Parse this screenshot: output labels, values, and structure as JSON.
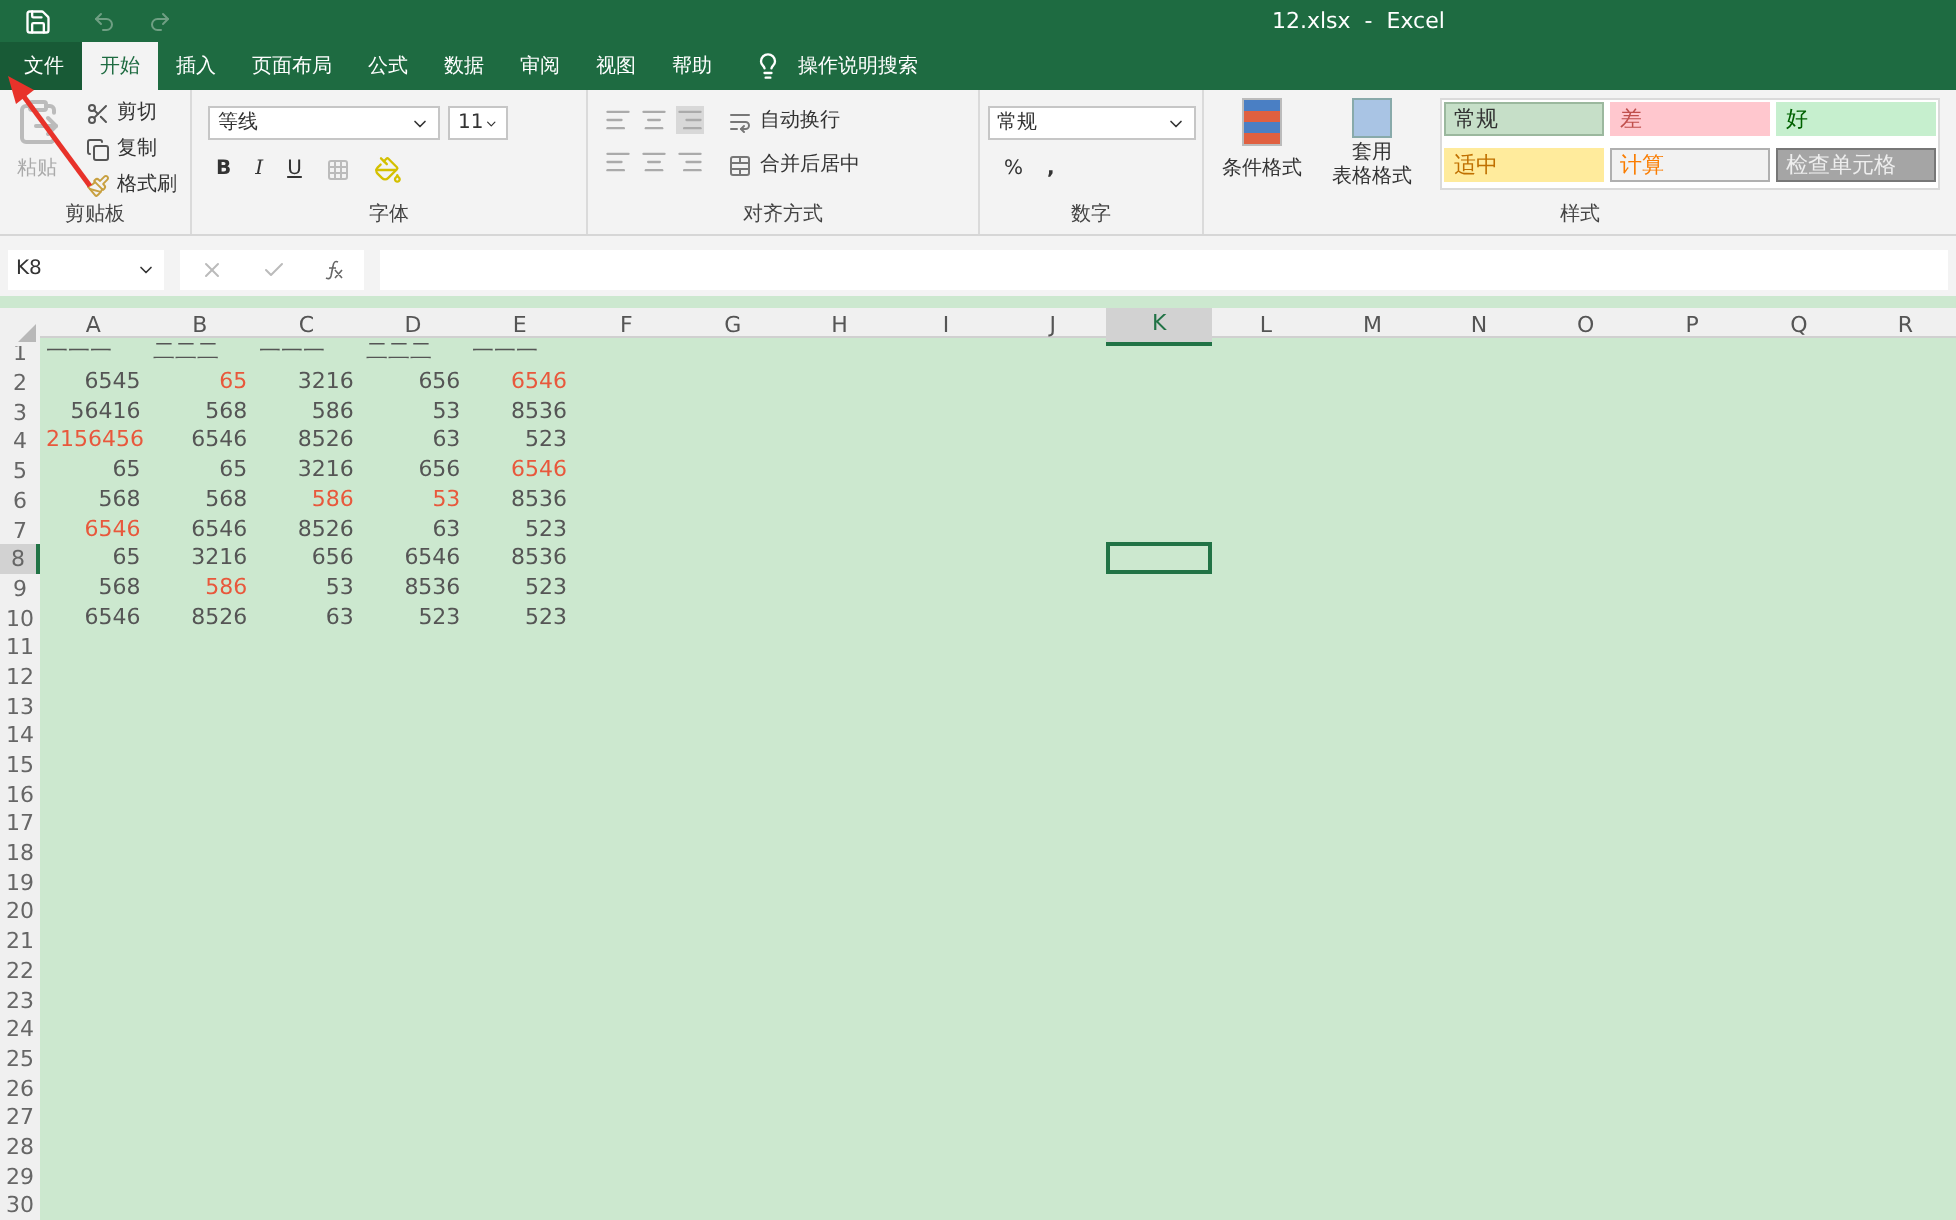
{
  "title": "12.xlsx  -  Excel",
  "tabs": [
    {
      "label": "文件",
      "selected": false,
      "kind": "file"
    },
    {
      "label": "开始",
      "selected": true,
      "kind": "tab"
    },
    {
      "label": "插入",
      "selected": false,
      "kind": "tab"
    },
    {
      "label": "页面布局",
      "selected": false,
      "kind": "tab"
    },
    {
      "label": "公式",
      "selected": false,
      "kind": "tab"
    },
    {
      "label": "数据",
      "selected": false,
      "kind": "tab"
    },
    {
      "label": "审阅",
      "selected": false,
      "kind": "tab"
    },
    {
      "label": "视图",
      "selected": false,
      "kind": "tab"
    },
    {
      "label": "帮助",
      "selected": false,
      "kind": "tab"
    }
  ],
  "tell_me": "操作说明搜索",
  "clipboard": {
    "paste": "粘贴",
    "cut": "剪切",
    "copy": "复制",
    "format_painter": "格式刷",
    "label": "剪贴板"
  },
  "font": {
    "name": "等线",
    "size": "11",
    "bold": "B",
    "italic": "I",
    "underline": "U",
    "label": "字体"
  },
  "alignment": {
    "wrap": "自动换行",
    "merge": "合并后居中",
    "label": "对齐方式"
  },
  "number": {
    "format": "常规",
    "percent": "%",
    "comma": ",",
    "label": "数字"
  },
  "styles": {
    "conditional": "条件格式",
    "table_format": [
      "套用",
      "表格格式"
    ],
    "label": "样式",
    "cells": [
      {
        "label": "常规",
        "kind": "normal"
      },
      {
        "label": "差",
        "kind": "bad"
      },
      {
        "label": "好",
        "kind": "good"
      },
      {
        "label": "适中",
        "kind": "neutral"
      },
      {
        "label": "计算",
        "kind": "calc"
      },
      {
        "label": "检查单元格",
        "kind": "check"
      }
    ]
  },
  "name_box": "K8",
  "columns": [
    {
      "label": "A",
      "selected": false
    },
    {
      "label": "B",
      "selected": false
    },
    {
      "label": "C",
      "selected": false
    },
    {
      "label": "D",
      "selected": false
    },
    {
      "label": "E",
      "selected": false
    },
    {
      "label": "F",
      "selected": false
    },
    {
      "label": "G",
      "selected": false
    },
    {
      "label": "H",
      "selected": false
    },
    {
      "label": "I",
      "selected": false
    },
    {
      "label": "J",
      "selected": false
    },
    {
      "label": "K",
      "selected": true
    },
    {
      "label": "L",
      "selected": false
    },
    {
      "label": "M",
      "selected": false
    },
    {
      "label": "N",
      "selected": false
    },
    {
      "label": "O",
      "selected": false
    },
    {
      "label": "P",
      "selected": false
    },
    {
      "label": "Q",
      "selected": false
    },
    {
      "label": "R",
      "selected": false
    }
  ],
  "rows": [
    {
      "header": "1",
      "selected": false,
      "cells": [
        {
          "text": "一一一",
          "color": "#555555",
          "kind": "text"
        },
        {
          "text": "二二二",
          "color": "#555555",
          "kind": "text"
        },
        {
          "text": "一一一",
          "color": "#555555",
          "kind": "text"
        },
        {
          "text": "二二二",
          "color": "#555555",
          "kind": "text"
        },
        {
          "text": "一一一",
          "color": "#555555",
          "kind": "text"
        }
      ]
    },
    {
      "header": "2",
      "selected": false,
      "cells": [
        {
          "text": "6545",
          "color": "#555555"
        },
        {
          "text": "65",
          "color": "#e8583c"
        },
        {
          "text": "3216",
          "color": "#555555"
        },
        {
          "text": "656",
          "color": "#555555"
        },
        {
          "text": "6546",
          "color": "#e8583c"
        }
      ]
    },
    {
      "header": "3",
      "selected": false,
      "cells": [
        {
          "text": "56416",
          "color": "#555555"
        },
        {
          "text": "568",
          "color": "#555555"
        },
        {
          "text": "586",
          "color": "#555555"
        },
        {
          "text": "53",
          "color": "#555555"
        },
        {
          "text": "8536",
          "color": "#555555"
        }
      ]
    },
    {
      "header": "4",
      "selected": false,
      "cells": [
        {
          "text": "2156456",
          "color": "#e8583c"
        },
        {
          "text": "6546",
          "color": "#555555"
        },
        {
          "text": "8526",
          "color": "#555555"
        },
        {
          "text": "63",
          "color": "#555555"
        },
        {
          "text": "523",
          "color": "#555555"
        }
      ]
    },
    {
      "header": "5",
      "selected": false,
      "cells": [
        {
          "text": "65",
          "color": "#555555"
        },
        {
          "text": "65",
          "color": "#555555"
        },
        {
          "text": "3216",
          "color": "#555555"
        },
        {
          "text": "656",
          "color": "#555555"
        },
        {
          "text": "6546",
          "color": "#e8583c"
        }
      ]
    },
    {
      "header": "6",
      "selected": false,
      "cells": [
        {
          "text": "568",
          "color": "#555555"
        },
        {
          "text": "568",
          "color": "#555555"
        },
        {
          "text": "586",
          "color": "#e8583c"
        },
        {
          "text": "53",
          "color": "#e8583c"
        },
        {
          "text": "8536",
          "color": "#555555"
        }
      ]
    },
    {
      "header": "7",
      "selected": false,
      "cells": [
        {
          "text": "6546",
          "color": "#e8583c"
        },
        {
          "text": "6546",
          "color": "#555555"
        },
        {
          "text": "8526",
          "color": "#555555"
        },
        {
          "text": "63",
          "color": "#555555"
        },
        {
          "text": "523",
          "color": "#555555"
        }
      ]
    },
    {
      "header": "8",
      "selected": true,
      "cells": [
        {
          "text": "65",
          "color": "#555555"
        },
        {
          "text": "3216",
          "color": "#555555"
        },
        {
          "text": "656",
          "color": "#555555"
        },
        {
          "text": "6546",
          "color": "#555555"
        },
        {
          "text": "8536",
          "color": "#555555"
        }
      ]
    },
    {
      "header": "9",
      "selected": false,
      "cells": [
        {
          "text": "568",
          "color": "#555555"
        },
        {
          "text": "586",
          "color": "#e8583c"
        },
        {
          "text": "53",
          "color": "#555555"
        },
        {
          "text": "8536",
          "color": "#555555"
        },
        {
          "text": "523",
          "color": "#555555"
        }
      ]
    },
    {
      "header": "10",
      "selected": false,
      "cells": [
        {
          "text": "6546",
          "color": "#555555"
        },
        {
          "text": "8526",
          "color": "#555555"
        },
        {
          "text": "63",
          "color": "#555555"
        },
        {
          "text": "523",
          "color": "#555555"
        },
        {
          "text": "523",
          "color": "#555555"
        }
      ]
    },
    {
      "header": "11",
      "selected": false
    },
    {
      "header": "12",
      "selected": false
    },
    {
      "header": "13",
      "selected": false
    },
    {
      "header": "14",
      "selected": false
    },
    {
      "header": "15",
      "selected": false
    },
    {
      "header": "16",
      "selected": false
    },
    {
      "header": "17",
      "selected": false
    },
    {
      "header": "18",
      "selected": false
    },
    {
      "header": "19",
      "selected": false
    },
    {
      "header": "20",
      "selected": false
    },
    {
      "header": "21",
      "selected": false
    },
    {
      "header": "22",
      "selected": false
    },
    {
      "header": "23",
      "selected": false
    },
    {
      "header": "24",
      "selected": false
    },
    {
      "header": "25",
      "selected": false
    },
    {
      "header": "26",
      "selected": false
    },
    {
      "header": "27",
      "selected": false
    },
    {
      "header": "28",
      "selected": false
    },
    {
      "header": "29",
      "selected": false
    },
    {
      "header": "30",
      "selected": false
    }
  ]
}
